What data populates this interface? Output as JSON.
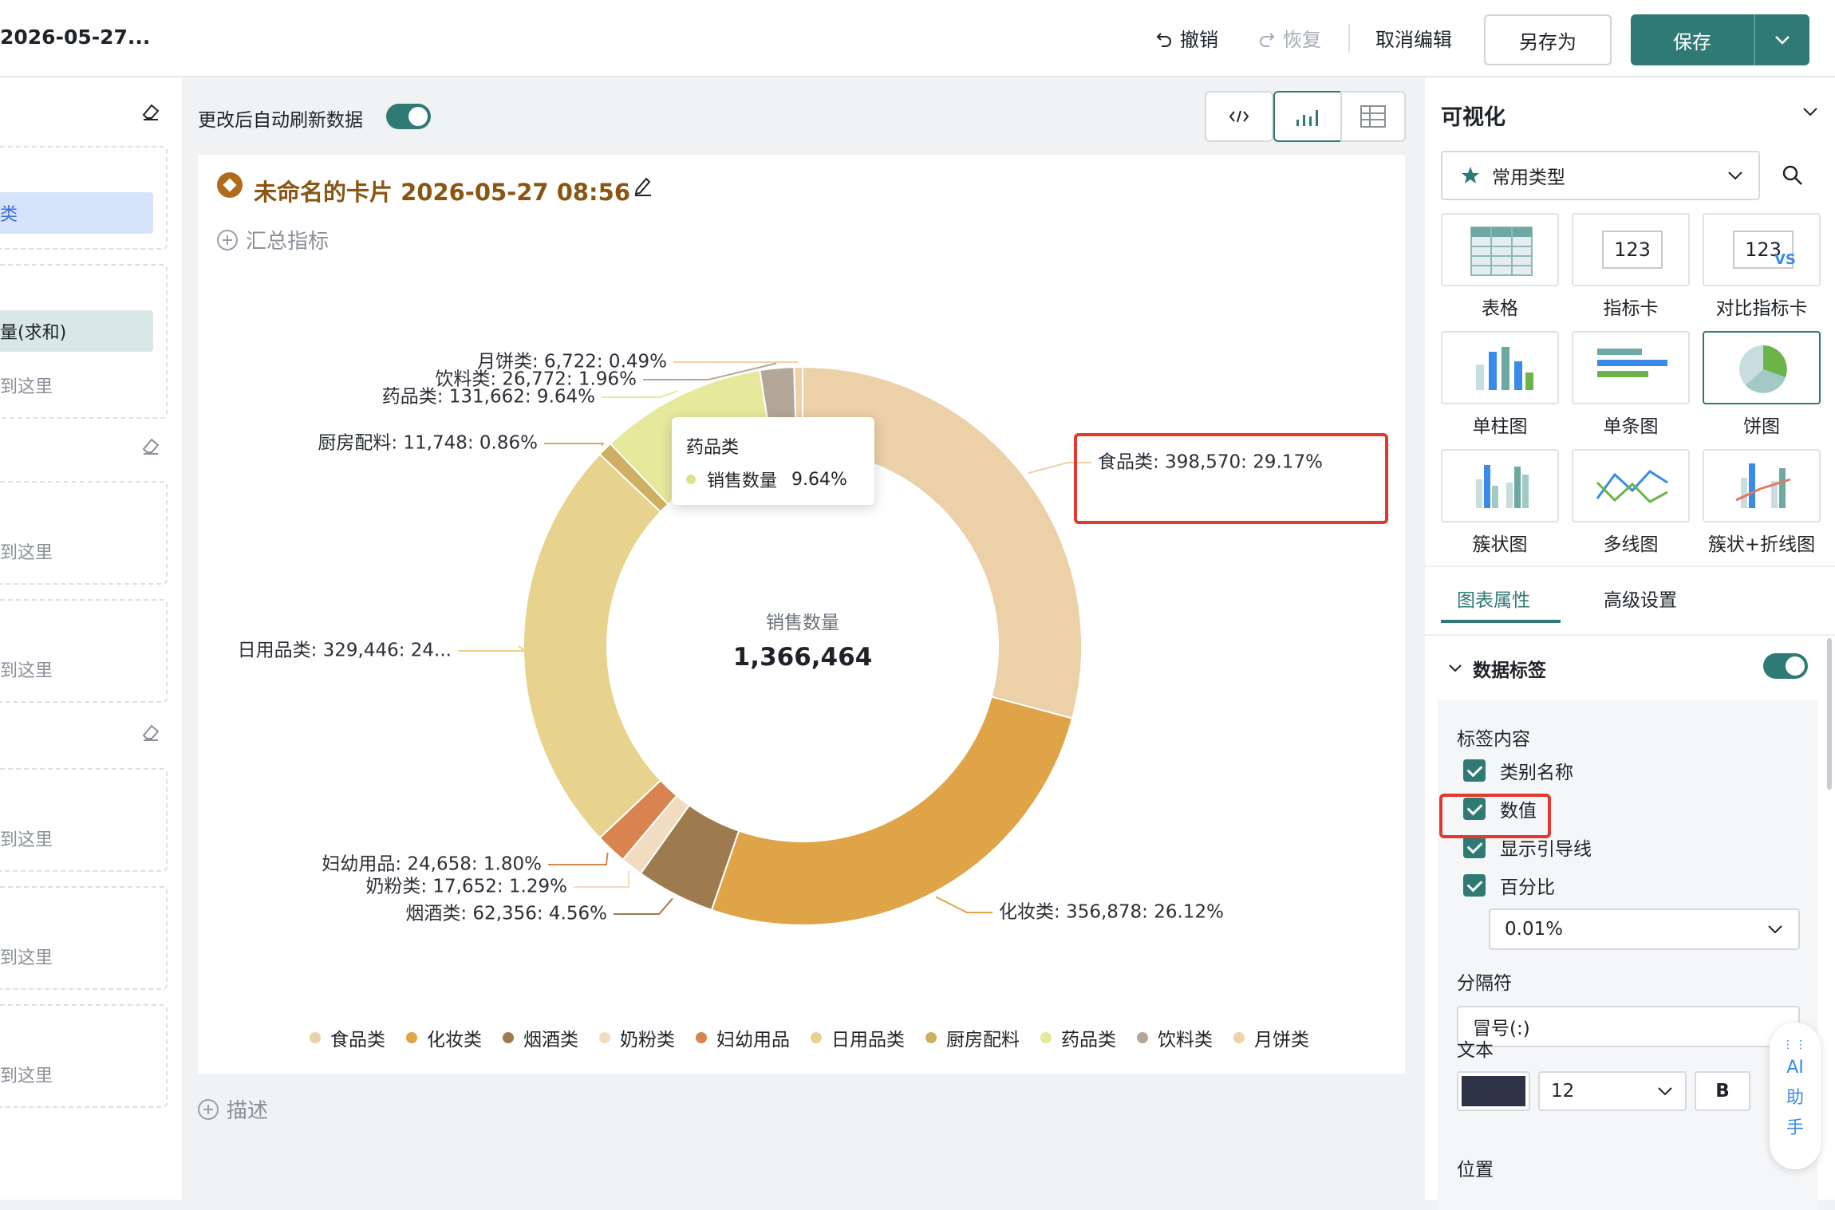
{
  "header": {
    "title": "2026-05-27...",
    "undo_label": "撤销",
    "redo_label": "恢复",
    "cancel_edit_label": "取消编辑",
    "save_as_label": "另存为",
    "save_label": "保存"
  },
  "left": {
    "chip1": "类",
    "chip2": "量(求和)",
    "drop_hint": "到这里"
  },
  "toolbar": {
    "auto_refresh_label": "更改后自动刷新数据",
    "auto_refresh_on": true
  },
  "card": {
    "title": "未命名的卡片 2026-05-27 08:56",
    "add_metric_label": "汇总指标",
    "describe_label": "描述",
    "center_label": "销售数量",
    "center_value": "1,366,464"
  },
  "tooltip": {
    "title": "药品类",
    "series": "销售数量",
    "value": "9.64%"
  },
  "chart_data": {
    "type": "pie",
    "donut": true,
    "series_name": "销售数量",
    "total": 1366464,
    "categories": [
      "食品类",
      "化妆类",
      "烟酒类",
      "奶粉类",
      "妇幼用品",
      "日用品类",
      "厨房配料",
      "药品类",
      "饮料类",
      "月饼类"
    ],
    "values": [
      398570,
      356878,
      62356,
      17652,
      24658,
      329446,
      11748,
      131662,
      26772,
      6722
    ],
    "percents": [
      29.17,
      26.12,
      4.56,
      1.29,
      1.8,
      24.11,
      0.86,
      9.64,
      1.96,
      0.49
    ],
    "colors": [
      "#ebd0a8",
      "#dea447",
      "#9d7b4e",
      "#f1dcc2",
      "#d9844f",
      "#e7d38e",
      "#cfb062",
      "#e6e89c",
      "#b3a79a",
      "#efd2aa"
    ],
    "labels": [
      "食品类: 398,570: 29.17%",
      "化妆类: 356,878: 26.12%",
      "烟酒类: 62,356: 4.56%",
      "奶粉类: 17,652: 1.29%",
      "妇幼用品: 24,658: 1.80%",
      "日用品类: 329,446: 24...",
      "厨房配料: 11,748: 0.86%",
      "药品类: 131,662: 9.64%",
      "饮料类: 26,772: 1.96%",
      "月饼类: 6,722: 0.49%"
    ],
    "legend_position": "bottom"
  },
  "right": {
    "title": "可视化",
    "type_select": "常用类型",
    "chart_types": [
      {
        "label": "表格"
      },
      {
        "label": "指标卡"
      },
      {
        "label": "对比指标卡"
      },
      {
        "label": "单柱图"
      },
      {
        "label": "单条图"
      },
      {
        "label": "饼图"
      },
      {
        "label": "簇状图"
      },
      {
        "label": "多线图"
      },
      {
        "label": "簇状+折线图"
      }
    ],
    "kpi_text": "123",
    "vs_text": "VS",
    "tab_props": "图表属性",
    "tab_advanced": "高级设置",
    "section_title": "数据标签",
    "label_content": "标签内容",
    "cb_category": "类别名称",
    "cb_value": "数值",
    "cb_leader": "显示引导线",
    "cb_percent": "百分比",
    "precision": "0.01%",
    "separator_label": "分隔符",
    "separator_value": "冒号(:)",
    "text_label": "文本",
    "font_size": "12",
    "bold": "B",
    "position_label": "位置",
    "ai_label": [
      "AI",
      "助",
      "手"
    ],
    "accent": "#2f7a74"
  }
}
